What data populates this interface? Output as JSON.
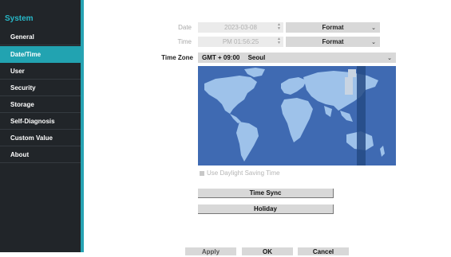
{
  "sidebar": {
    "title": "System",
    "items": [
      {
        "label": "General"
      },
      {
        "label": "Date/Time",
        "active": true
      },
      {
        "label": "User"
      },
      {
        "label": "Security"
      },
      {
        "label": "Storage"
      },
      {
        "label": "Self-Diagnosis"
      },
      {
        "label": "Custom Value"
      },
      {
        "label": "About"
      }
    ]
  },
  "form": {
    "date_label": "Date",
    "date_value": "2023-03-08",
    "time_label": "Time",
    "time_value": "PM 01:56:25",
    "format_date": "Format",
    "format_time": "Format",
    "tz_label": "Time Zone",
    "tz_offset": "GMT + 09:00",
    "tz_city": "Seoul",
    "dst_label": "Use Daylight Saving Time",
    "time_sync": "Time Sync",
    "holiday": "Holiday"
  },
  "footer": {
    "apply": "Apply",
    "ok": "OK",
    "cancel": "Cancel"
  },
  "colors": {
    "sidebar_bg": "#212529",
    "accent": "#22a3b1",
    "map_ocean": "#3f6ab2",
    "map_land": "#9ec2ea",
    "map_zone": "#244a84"
  }
}
